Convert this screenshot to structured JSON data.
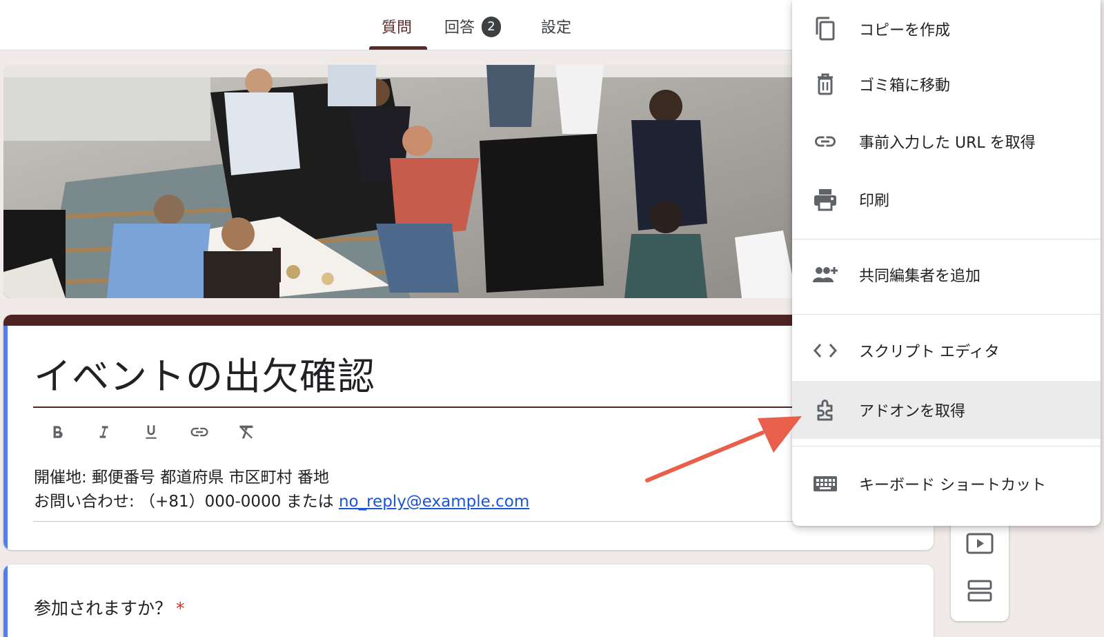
{
  "tabs": [
    {
      "label": "質問",
      "active": true
    },
    {
      "label": "回答",
      "badge": "2"
    },
    {
      "label": "設定"
    }
  ],
  "form": {
    "title": "イベントの出欠確認",
    "description_line1": "開催地: 郵便番号 都道府県 市区町村 番地",
    "description_line2_prefix": "お問い合わせ: （+81）000-0000 または ",
    "description_link": "no_reply@example.com",
    "format_toolbar": [
      "bold-icon",
      "italic-icon",
      "underline-icon",
      "link-icon",
      "clear-format-icon"
    ]
  },
  "question": {
    "text": "参加されますか？",
    "required_mark": "*"
  },
  "menu": {
    "items": [
      {
        "label": "コピーを作成",
        "icon": "copy-icon"
      },
      {
        "label": "ゴミ箱に移動",
        "icon": "trash-icon"
      },
      {
        "label": "事前入力した URL を取得",
        "icon": "link-icon"
      },
      {
        "label": "印刷",
        "icon": "print-icon"
      },
      {
        "label": "共同編集者を追加",
        "icon": "add-people-icon"
      },
      {
        "label": "スクリプト エディタ",
        "icon": "code-icon"
      },
      {
        "label": "アドオンを取得",
        "icon": "puzzle-icon",
        "highlighted": true
      },
      {
        "label": "キーボード ショートカット",
        "icon": "keyboard-icon"
      }
    ]
  },
  "side_toolbar": [
    "add-video-icon",
    "add-section-icon"
  ],
  "colors": {
    "theme": "#4f2424",
    "accent": "#4f7ef0",
    "annotation_arrow": "#e8604c",
    "link": "#1a55d2"
  }
}
